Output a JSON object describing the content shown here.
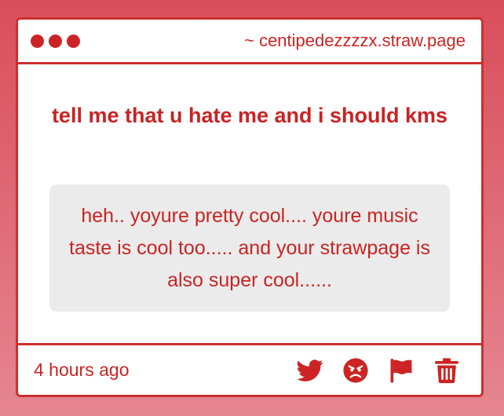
{
  "window": {
    "url": "~ centipedezzzzx.straw.page"
  },
  "post": {
    "question": "tell me that u hate me and i should kms",
    "answer": "heh.. yoyure pretty cool.... youre music taste is cool too..... and your strawpage is also super cool......",
    "timestamp": "4 hours ago"
  },
  "actions": [
    {
      "icon": "twitter-icon"
    },
    {
      "icon": "angry-face-icon"
    },
    {
      "icon": "flag-icon"
    },
    {
      "icon": "trash-icon"
    }
  ],
  "colors": {
    "accent": "#cc2424",
    "background_top": "#d94e5b",
    "background_bottom": "#e58690",
    "answer_bg": "#ebebeb"
  }
}
